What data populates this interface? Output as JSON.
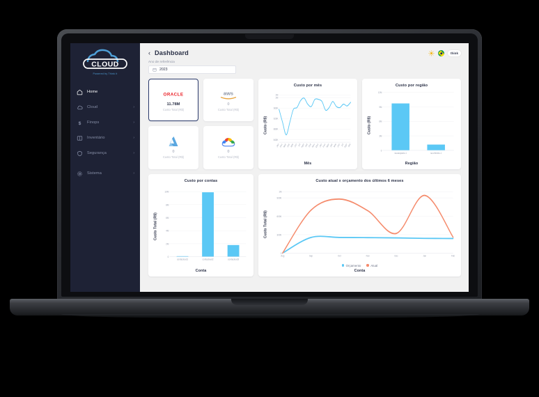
{
  "sidebar": {
    "logo": {
      "text": "CLOUD",
      "tagline": "Powered by Think it"
    },
    "items": [
      {
        "label": "Home",
        "icon": "home-icon",
        "expandable": false,
        "active": true
      },
      {
        "label": "Cloud",
        "icon": "cloud-icon",
        "expandable": true,
        "active": false
      },
      {
        "label": "Finops",
        "icon": "dollar-icon",
        "expandable": true,
        "active": false
      },
      {
        "label": "Inventário",
        "icon": "book-icon",
        "expandable": true,
        "active": false
      },
      {
        "label": "Segurança",
        "icon": "shield-icon",
        "expandable": true,
        "active": false
      },
      {
        "label": "Sistema",
        "icon": "gear-icon",
        "expandable": true,
        "active": false
      }
    ],
    "chevron": "›"
  },
  "header": {
    "back": "‹",
    "title": "Dashboard",
    "theme_toggle_icon": "sun-icon",
    "language_icon": "brazil-flag-icon",
    "brand_badge": "think"
  },
  "filter": {
    "label": "Ano de referência",
    "value": "2023",
    "placeholder": "2023",
    "icon": "calendar-icon"
  },
  "providers": [
    {
      "name": "Oracle",
      "logo": "oracle-logo",
      "value": "11.78M",
      "sub": "Custo Total (R$)",
      "selected": true
    },
    {
      "name": "AWS",
      "logo": "aws-logo",
      "value": "0",
      "sub": "Custo Total (R$)",
      "selected": false
    },
    {
      "name": "Azure",
      "logo": "azure-logo",
      "value": "0",
      "sub": "Custo Total (R$)",
      "selected": false
    },
    {
      "name": "Google Cloud",
      "logo": "gcp-logo",
      "value": "0",
      "sub": "Custo Total (R$)",
      "selected": false
    }
  ],
  "colors": {
    "accent_blue": "#5bc8f5",
    "accent_orange": "#f58b6c",
    "sidebar_bg": "#1e2235",
    "text_dark": "#2b3147"
  },
  "chart_data": [
    {
      "id": "custo-por-mes",
      "type": "line",
      "title": "Custo por mês",
      "xlabel": "Mês",
      "ylabel": "Custo (R$)",
      "ylim": [
        830000,
        1020000
      ],
      "yticks": [
        840000,
        880000,
        920000,
        960000,
        1000000,
        1010000
      ],
      "ytick_labels": [
        "840K",
        "880K",
        "920K",
        "960K",
        "1M",
        "1M"
      ],
      "grid": true,
      "legend": "none",
      "categories": [
        "Jan",
        "Fev",
        "Mar",
        "Abr",
        "Mai",
        "Jun",
        "Jul",
        "Ago",
        "Set",
        "Out",
        "Nov",
        "Dez",
        "Jan",
        "Fev",
        "Mar",
        "Abr",
        "Mai",
        "Jun",
        "Jul",
        "Ago",
        "Set"
      ],
      "values": [
        955000,
        905000,
        858000,
        905000,
        955000,
        962000,
        988000,
        998000,
        975000,
        966000,
        993000,
        993000,
        985000,
        952000,
        962000,
        985000,
        966000,
        962000,
        975000,
        968000,
        982000
      ],
      "color": "#5bc8f5"
    },
    {
      "id": "custo-por-regiao",
      "type": "bar",
      "title": "Custo por região",
      "xlabel": "Região",
      "ylabel": "Custo (R$)",
      "ylim": [
        0,
        12000000
      ],
      "yticks": [
        0,
        3000000,
        6000000,
        9000000,
        12000000
      ],
      "ytick_labels": [
        "0",
        "3M",
        "6M",
        "9M",
        "12M"
      ],
      "grid": true,
      "categories": [
        "sa-saopaulo-1",
        "sa-vinhedo-1"
      ],
      "values": [
        9700000,
        1200000
      ],
      "color": "#5bc8f5"
    },
    {
      "id": "custo-por-contas",
      "type": "bar",
      "title": "Custo por contas",
      "xlabel": "Conta",
      "ylabel": "Custo Total (R$)",
      "ylim": [
        0,
        10600000
      ],
      "yticks": [
        0,
        2000000,
        4000000,
        6000000,
        8000000,
        10000000
      ],
      "ytick_labels": [
        "0",
        "2M",
        "4M",
        "6M",
        "8M",
        "10M"
      ],
      "grid": true,
      "categories": [
        "contacloud1",
        "contacloud2",
        "contacloud3"
      ],
      "values": [
        90000,
        9900000,
        1800000
      ],
      "color": "#5bc8f5"
    },
    {
      "id": "custo-atual-x-orcamento",
      "type": "line",
      "title": "Custo atual x orçamento dos últimos 6 meses",
      "xlabel": "Conta",
      "ylabel": "Custo Total (R$)",
      "ylim": [
        0,
        1050000
      ],
      "yticks": [
        0,
        300000,
        600000,
        900000,
        1000000
      ],
      "ytick_labels": [
        "0",
        "300K",
        "600K",
        "900K",
        "1M"
      ],
      "grid": true,
      "legend": "bottom",
      "categories": [
        "Aug",
        "Sep",
        "Oct",
        "Nov",
        "Dec",
        "Jan",
        "Feb"
      ],
      "series": [
        {
          "name": "Orçamento",
          "color": "#5bc8f5",
          "values": [
            0,
            255000,
            255000,
            252000,
            248000,
            240000,
            238000
          ]
        },
        {
          "name": "Atual",
          "color": "#f58b6c",
          "values": [
            0,
            700000,
            880000,
            690000,
            320000,
            940000,
            260000
          ]
        }
      ]
    }
  ]
}
